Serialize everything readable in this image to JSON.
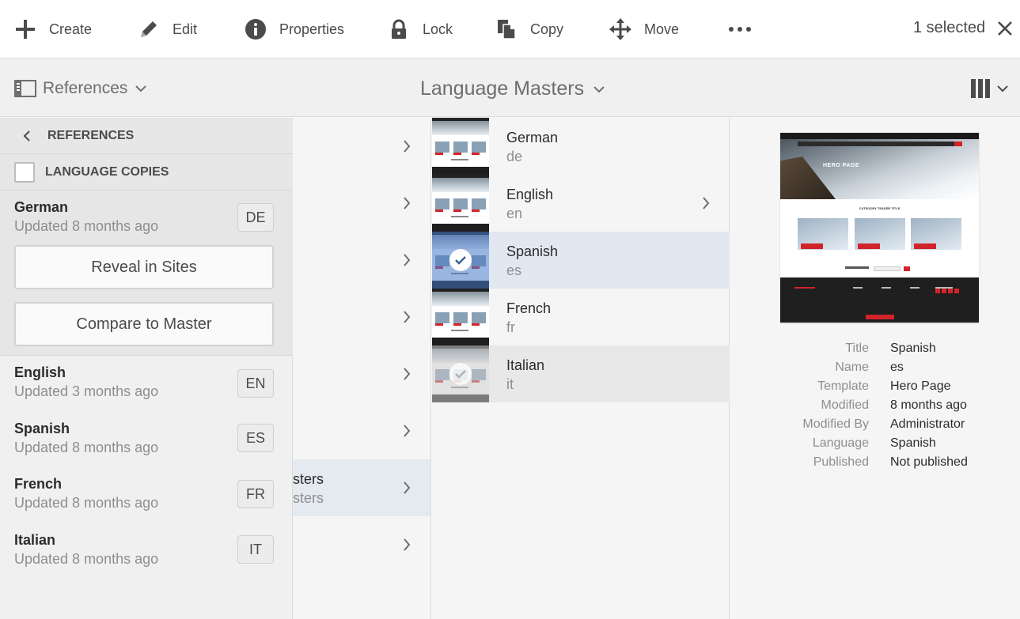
{
  "actionbar": {
    "actions": [
      {
        "label": "Create",
        "icon": "plus-icon"
      },
      {
        "label": "Edit",
        "icon": "pencil-icon"
      },
      {
        "label": "Properties",
        "icon": "info-icon"
      },
      {
        "label": "Lock",
        "icon": "lock-icon"
      },
      {
        "label": "Copy",
        "icon": "copy-icon"
      },
      {
        "label": "Move",
        "icon": "move-icon"
      }
    ],
    "more_icon": "ellipsis-icon",
    "selected_count": "1 selected",
    "close_icon": "close-icon"
  },
  "subbar": {
    "rail_label": "References",
    "title": "Language Masters",
    "view_icon": "column-view-icon"
  },
  "rail": {
    "back_label": "REFERENCES",
    "section_label": "LANGUAGE COPIES",
    "expanded": {
      "name": "German",
      "updated": "Updated 8 months ago",
      "code": "DE",
      "reveal_button": "Reveal in Sites",
      "compare_button": "Compare to Master"
    },
    "copies": [
      {
        "name": "English",
        "updated": "Updated 3 months ago",
        "code": "EN"
      },
      {
        "name": "Spanish",
        "updated": "Updated 8 months ago",
        "code": "ES"
      },
      {
        "name": "French",
        "updated": "Updated 8 months ago",
        "code": "FR"
      },
      {
        "name": "Italian",
        "updated": "Updated 8 months ago",
        "code": "IT"
      }
    ]
  },
  "column1": {
    "active_item": {
      "title": "sters",
      "subtitle": "sters"
    }
  },
  "column2": {
    "items": [
      {
        "title": "German",
        "subtitle": "de"
      },
      {
        "title": "English",
        "subtitle": "en"
      },
      {
        "title": "Spanish",
        "subtitle": "es"
      },
      {
        "title": "French",
        "subtitle": "fr"
      },
      {
        "title": "Italian",
        "subtitle": "it"
      }
    ]
  },
  "preview": {
    "thumbnail": {
      "hero_text": "HERO PAGE",
      "category_text": "CATEGORY TEASER TITLE"
    },
    "properties": [
      {
        "label": "Title",
        "value": "Spanish"
      },
      {
        "label": "Name",
        "value": "es"
      },
      {
        "label": "Template",
        "value": "Hero Page"
      },
      {
        "label": "Modified",
        "value": "8 months ago"
      },
      {
        "label": "Modified By",
        "value": "Administrator"
      },
      {
        "label": "Language",
        "value": "Spanish"
      },
      {
        "label": "Published",
        "value": "Not published"
      }
    ]
  },
  "colors": {
    "accent_selected": "#e2e8f1",
    "brand_red": "#d2232a",
    "text": "#4b4b4b"
  }
}
